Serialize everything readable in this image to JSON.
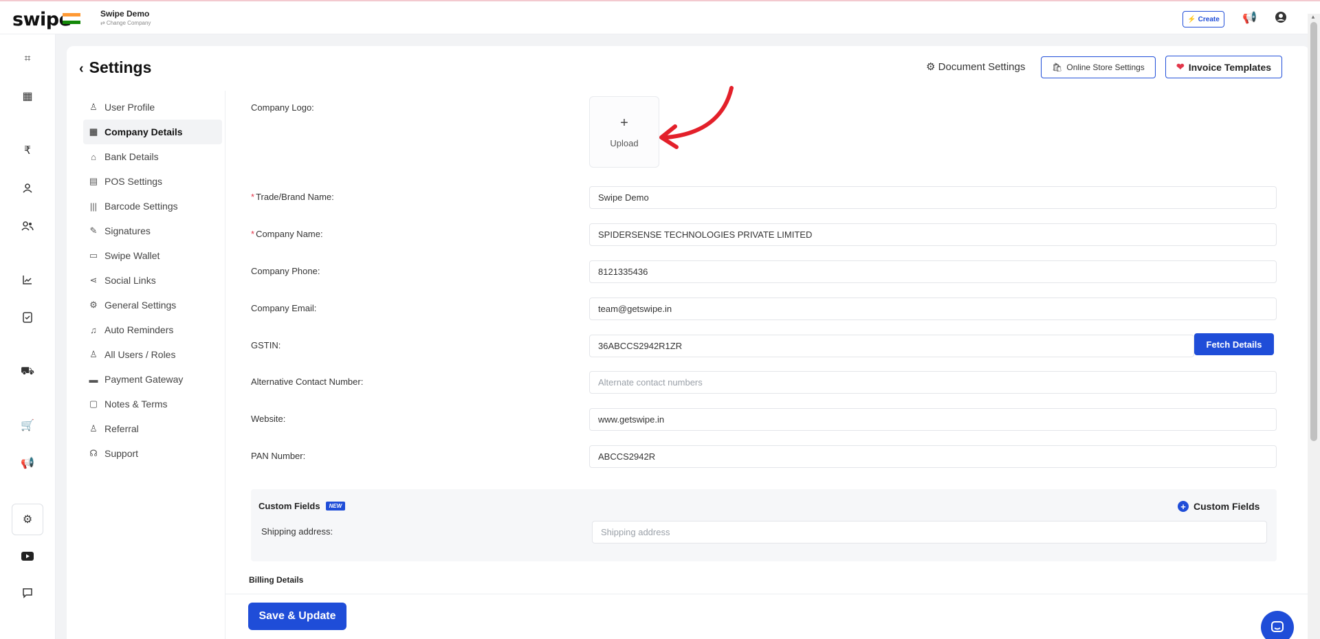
{
  "app": {
    "logo_text": "swipe",
    "company_name": "Swipe Demo",
    "change_company": "⇄ Change Company",
    "create_label": "Create",
    "flag_colors": [
      "#FF9933",
      "#FFFFFF",
      "#138808"
    ]
  },
  "rail": {
    "icons": [
      "scan-icon",
      "dashboard-icon",
      "rupee-icon",
      "user-icon",
      "users-icon",
      "analytics-icon",
      "document-icon",
      "truck-icon",
      "store-icon",
      "megaphone-icon",
      "settings-icon",
      "youtube-icon",
      "chat-icon"
    ]
  },
  "header": {
    "title": "Settings",
    "document_settings": "Document Settings",
    "online_store_settings": "Online Store Settings",
    "invoice_templates": "Invoice Templates"
  },
  "menu": {
    "items": [
      {
        "label": "User Profile",
        "icon": "user-icon",
        "glyph": "♙"
      },
      {
        "label": "Company Details",
        "icon": "building-icon",
        "glyph": "▦",
        "active": true
      },
      {
        "label": "Bank Details",
        "icon": "bank-icon",
        "glyph": "⌂"
      },
      {
        "label": "POS Settings",
        "icon": "pos-icon",
        "glyph": "▤"
      },
      {
        "label": "Barcode Settings",
        "icon": "barcode-icon",
        "glyph": "|||"
      },
      {
        "label": "Signatures",
        "icon": "signature-icon",
        "glyph": "✎"
      },
      {
        "label": "Swipe Wallet",
        "icon": "wallet-icon",
        "glyph": "▭"
      },
      {
        "label": "Social Links",
        "icon": "share-icon",
        "glyph": "⋖"
      },
      {
        "label": "General Settings",
        "icon": "gear-icon",
        "glyph": "⚙"
      },
      {
        "label": "Auto Reminders",
        "icon": "bell-icon",
        "glyph": "♫"
      },
      {
        "label": "All Users / Roles",
        "icon": "team-icon",
        "glyph": "♙"
      },
      {
        "label": "Payment Gateway",
        "icon": "card-icon",
        "glyph": "▬"
      },
      {
        "label": "Notes & Terms",
        "icon": "note-icon",
        "glyph": "▢"
      },
      {
        "label": "Referral",
        "icon": "referral-icon",
        "glyph": "♙"
      },
      {
        "label": "Support",
        "icon": "headset-icon",
        "glyph": "☊"
      }
    ]
  },
  "form": {
    "logo_label": "Company Logo",
    "upload_text": "Upload",
    "trade_name_label": "Trade/Brand Name",
    "trade_name_value": "Swipe Demo",
    "company_name_label": "Company Name",
    "company_name_value": "SPIDERSENSE TECHNOLOGIES PRIVATE LIMITED",
    "phone_label": "Company Phone",
    "phone_value": "8121335436",
    "email_label": "Company Email",
    "email_value": "team@getswipe.in",
    "gstin_label": "GSTIN",
    "gstin_value": "36ABCCS2942R1ZR",
    "fetch_details": "Fetch Details",
    "alt_contact_label": "Alternative Contact Number",
    "alt_contact_placeholder": "Alternate contact numbers",
    "website_label": "Website",
    "website_value": "www.getswipe.in",
    "pan_label": "PAN Number",
    "pan_value": "ABCCS2942R",
    "label_suffix": ":"
  },
  "custom_fields": {
    "title": "Custom Fields",
    "badge": "NEW",
    "add_label": "Custom Fields",
    "shipping_label": "Shipping address",
    "shipping_placeholder": "Shipping address"
  },
  "billing": {
    "title": "Billing Details"
  },
  "footer": {
    "save_label": "Save & Update"
  },
  "colors": {
    "primary": "#1f4dd8",
    "required": "#e2364a",
    "arrow": "#e3202a"
  }
}
